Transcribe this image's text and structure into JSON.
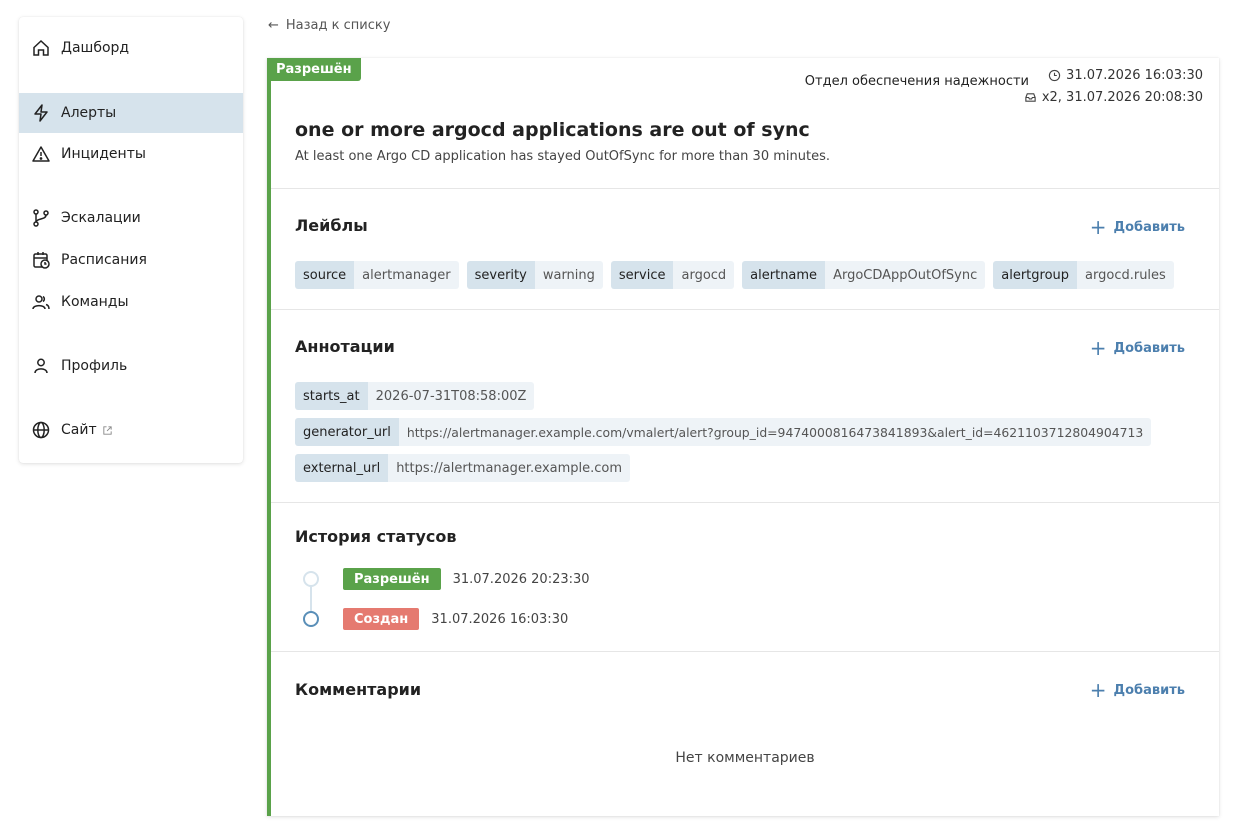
{
  "sidebar": {
    "items": [
      {
        "label": "Дашборд",
        "icon": "home-icon"
      },
      {
        "label": "Алерты",
        "icon": "lightning-icon",
        "active": true
      },
      {
        "label": "Инциденты",
        "icon": "warning-icon"
      },
      {
        "label": "Эскалации",
        "icon": "git-branch-icon"
      },
      {
        "label": "Расписания",
        "icon": "calendar-clock-icon"
      },
      {
        "label": "Команды",
        "icon": "users-icon"
      },
      {
        "label": "Профиль",
        "icon": "user-icon"
      },
      {
        "label": "Сайт",
        "icon": "globe-icon",
        "external": true
      }
    ]
  },
  "back_link": "Назад к списку",
  "alert": {
    "status": "Разрешён",
    "team": "Отдел обеспечения надежности",
    "created_at": "31.07.2026 16:03:30",
    "repeat": "x2, 31.07.2026 20:08:30",
    "title": "one or more argocd applications are out of sync",
    "description": "At least one Argo CD application has stayed OutOfSync for more than 30 minutes."
  },
  "labels": {
    "title": "Лейблы",
    "add": "Добавить",
    "items": [
      {
        "key": "source",
        "value": "alertmanager"
      },
      {
        "key": "severity",
        "value": "warning"
      },
      {
        "key": "service",
        "value": "argocd"
      },
      {
        "key": "alertname",
        "value": "ArgoCDAppOutOfSync"
      },
      {
        "key": "alertgroup",
        "value": "argocd.rules"
      }
    ]
  },
  "annotations": {
    "title": "Аннотации",
    "add": "Добавить",
    "items": [
      {
        "key": "starts_at",
        "value": "2026-07-31T08:58:00Z"
      },
      {
        "key": "generator_url",
        "value": "https://alertmanager.example.com/vmalert/alert?group_id=9474000816473841893&alert_id=4621103712804904713"
      },
      {
        "key": "external_url",
        "value": "https://alertmanager.example.com"
      }
    ]
  },
  "history": {
    "title": "История статусов",
    "items": [
      {
        "status": "Разрешён",
        "time": "31.07.2026 20:23:30"
      },
      {
        "status": "Создан",
        "time": "31.07.2026 16:03:30"
      }
    ]
  },
  "comments": {
    "title": "Комментарии",
    "add": "Добавить",
    "empty": "Нет комментариев"
  },
  "colors": {
    "resolved": "#5aa24a",
    "created": "#e57a70",
    "accent": "#4c7fae",
    "active_nav": "#d6e3ec"
  }
}
